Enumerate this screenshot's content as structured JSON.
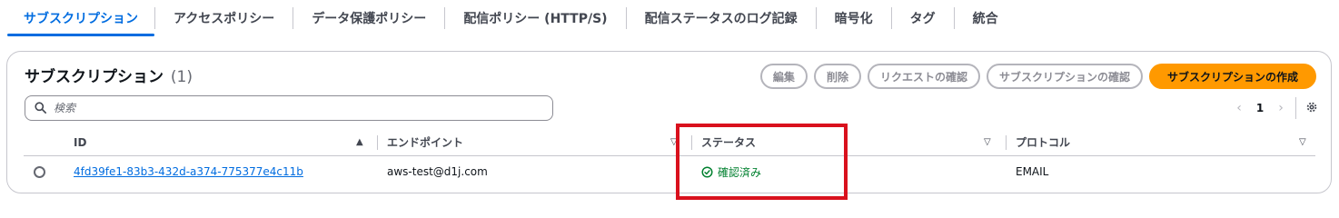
{
  "tabs": [
    {
      "label": "サブスクリプション"
    },
    {
      "label": "アクセスポリシー"
    },
    {
      "label": "データ保護ポリシー"
    },
    {
      "label": "配信ポリシー (HTTP/S)"
    },
    {
      "label": "配信ステータスのログ記録"
    },
    {
      "label": "暗号化"
    },
    {
      "label": "タグ"
    },
    {
      "label": "統合"
    }
  ],
  "panel": {
    "title": "サブスクリプション",
    "count": "(1)"
  },
  "actions": {
    "edit": "編集",
    "delete": "削除",
    "request_confirm": "リクエストの確認",
    "confirm_subscription": "サブスクリプションの確認",
    "create_subscription": "サブスクリプションの作成"
  },
  "search": {
    "placeholder": "検索"
  },
  "pagination": {
    "current_page": "1"
  },
  "table": {
    "columns": [
      "ID",
      "エンドポイント",
      "ステータス",
      "プロトコル"
    ],
    "rows": [
      {
        "id": "4fd39fe1-83b3-432d-a374-775377e4c11b",
        "endpoint": "aws-test@d1j.com",
        "status": "確認済み",
        "protocol": "EMAIL"
      }
    ]
  },
  "colors": {
    "accent": "#006ce0",
    "primary_button": "#ff9900",
    "success": "#00802f",
    "highlight": "#d9111d"
  },
  "icons": {
    "search": "search-icon",
    "status": "check-circle-icon",
    "settings": "gear-icon"
  }
}
